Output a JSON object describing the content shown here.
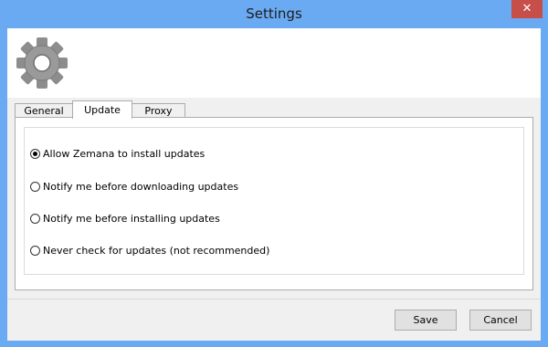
{
  "window": {
    "title": "Settings",
    "close_glyph": "✕"
  },
  "header": {
    "icon": "gear-icon",
    "icon_color": "#8a8a8a"
  },
  "tabs": [
    {
      "label": "General",
      "active": false
    },
    {
      "label": "Update",
      "active": true
    },
    {
      "label": "Proxy",
      "active": false
    }
  ],
  "update_options": {
    "selected_index": 0,
    "options": [
      {
        "label": "Allow Zemana to install updates",
        "checked": true
      },
      {
        "label": "Notify me before downloading updates",
        "checked": false
      },
      {
        "label": "Notify me before installing updates",
        "checked": false
      },
      {
        "label": "Never check for updates (not recommended)",
        "checked": false
      }
    ]
  },
  "buttons": {
    "save_label": "Save",
    "cancel_label": "Cancel"
  },
  "colors": {
    "title_bar": "#6aaaf3",
    "close_button": "#c74f4a",
    "client_bg": "#f0f0f0"
  }
}
